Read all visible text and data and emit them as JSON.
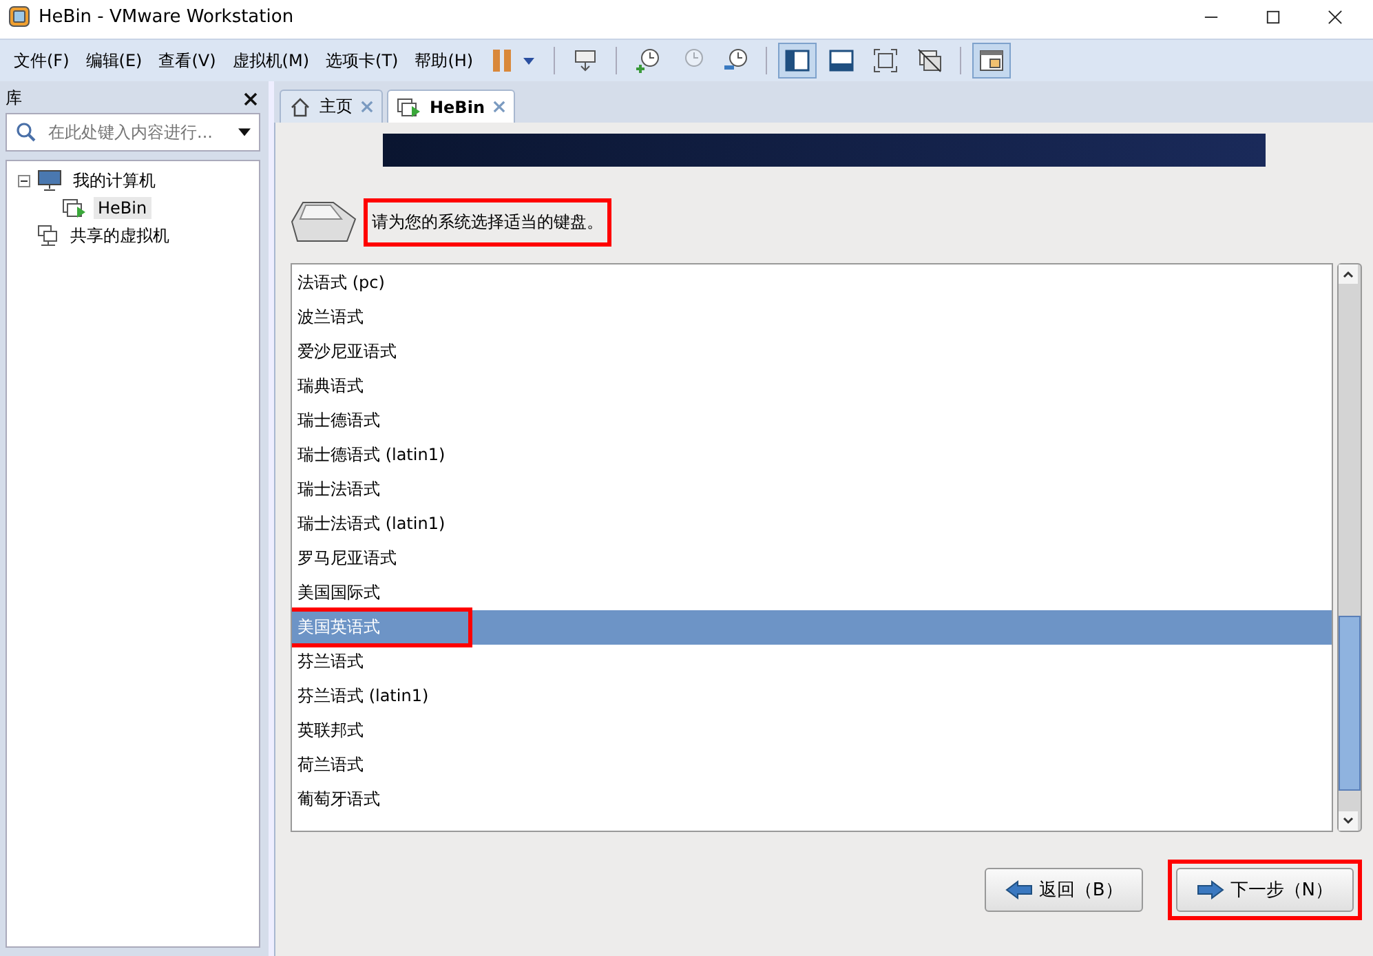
{
  "window": {
    "title": "HeBin - VMware Workstation"
  },
  "menu": [
    "文件(F)",
    "编辑(E)",
    "查看(V)",
    "虚拟机(M)",
    "选项卡(T)",
    "帮助(H)"
  ],
  "toolbar": [
    {
      "kind": "pause",
      "selected": false
    },
    {
      "kind": "sep"
    },
    {
      "kind": "send",
      "selected": false
    },
    {
      "kind": "sep"
    },
    {
      "kind": "snap",
      "selected": false
    },
    {
      "kind": "revert",
      "selected": false
    },
    {
      "kind": "manage",
      "selected": false
    },
    {
      "kind": "sep"
    },
    {
      "kind": "sidebar",
      "selected": true
    },
    {
      "kind": "thumb",
      "selected": false
    },
    {
      "kind": "full",
      "selected": false
    },
    {
      "kind": "unity",
      "selected": false
    },
    {
      "kind": "sep"
    },
    {
      "kind": "console",
      "selected": true
    }
  ],
  "library": {
    "title": "库",
    "search": {
      "placeholder": "在此处键入内容进行..."
    },
    "tree": [
      {
        "label": "我的计算机",
        "kind": "computer",
        "expanded": true,
        "selected": false,
        "children": [
          {
            "label": "HeBin",
            "kind": "vm",
            "selected": true
          }
        ]
      },
      {
        "label": "共享的虚拟机",
        "kind": "shared",
        "selected": false
      }
    ]
  },
  "tabs": [
    {
      "label": "主页",
      "kind": "home",
      "selected": false
    },
    {
      "label": "HeBin",
      "kind": "vm",
      "selected": true
    }
  ],
  "installer": {
    "prompt": "请为您的系统选择适当的键盘。",
    "prompt_highlighted": true,
    "keyboards": [
      {
        "label": "法语式 (pc)",
        "selected": false,
        "highlighted": false
      },
      {
        "label": "波兰语式",
        "selected": false,
        "highlighted": false
      },
      {
        "label": "爱沙尼亚语式",
        "selected": false,
        "highlighted": false
      },
      {
        "label": "瑞典语式",
        "selected": false,
        "highlighted": false
      },
      {
        "label": "瑞士德语式",
        "selected": false,
        "highlighted": false
      },
      {
        "label": "瑞士德语式 (latin1)",
        "selected": false,
        "highlighted": false
      },
      {
        "label": "瑞士法语式",
        "selected": false,
        "highlighted": false
      },
      {
        "label": "瑞士法语式 (latin1)",
        "selected": false,
        "highlighted": false
      },
      {
        "label": "罗马尼亚语式",
        "selected": false,
        "highlighted": false
      },
      {
        "label": "美国国际式",
        "selected": false,
        "highlighted": false
      },
      {
        "label": "美国英语式",
        "selected": true,
        "highlighted": true
      },
      {
        "label": "芬兰语式",
        "selected": false,
        "highlighted": false
      },
      {
        "label": "芬兰语式 (latin1)",
        "selected": false,
        "highlighted": false
      },
      {
        "label": "英联邦式",
        "selected": false,
        "highlighted": false
      },
      {
        "label": "荷兰语式",
        "selected": false,
        "highlighted": false
      },
      {
        "label": "葡萄牙语式",
        "selected": false,
        "highlighted": false
      }
    ],
    "buttons": [
      {
        "label": "返回（B）",
        "kind": "back",
        "highlighted": false
      },
      {
        "label": "下一步（N）",
        "kind": "next",
        "highlighted": true
      }
    ]
  }
}
